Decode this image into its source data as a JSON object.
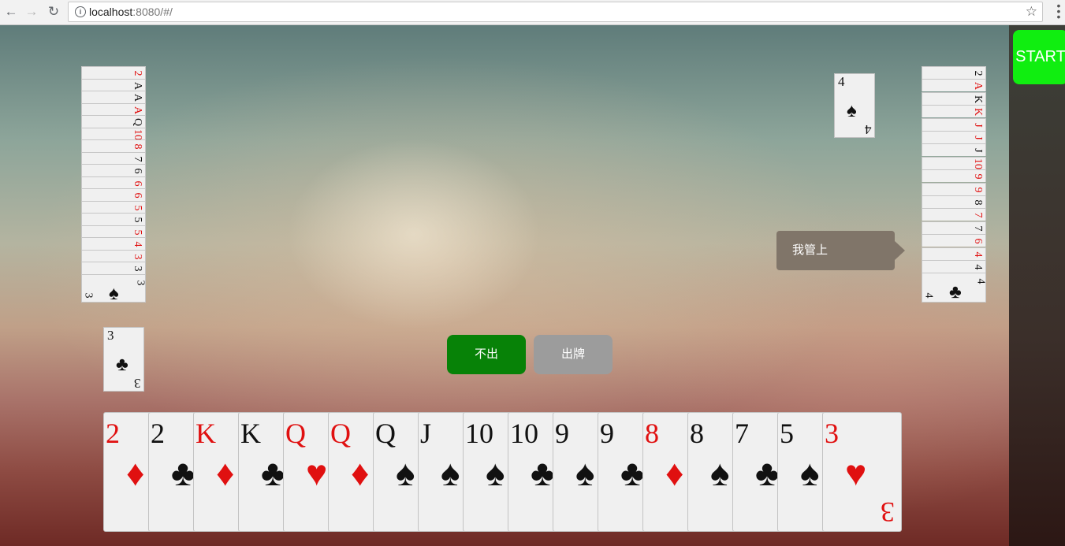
{
  "browser": {
    "url_host": "localhost",
    "url_rest": ":8080/#/",
    "back_icon": "←",
    "forward_icon": "→",
    "reload_icon": "↻",
    "star_icon": "☆",
    "menu_icon": "⋮"
  },
  "start_button": "START",
  "colors": {
    "start": "#10ee10",
    "pass": "#078207",
    "play": "#9c9c9c",
    "red_suit": "#e01010"
  },
  "left_player": {
    "stack_ranks": [
      "2",
      "A",
      "A",
      "A",
      "Q",
      "10",
      "8",
      "7",
      "6",
      "6",
      "6",
      "5",
      "5",
      "5",
      "4",
      "3",
      "3"
    ],
    "stack_colors": [
      "red",
      "black",
      "black",
      "red",
      "black",
      "red",
      "red",
      "black",
      "black",
      "red",
      "red",
      "red",
      "black",
      "red",
      "red",
      "red",
      "black"
    ],
    "last_card": {
      "rank": "3",
      "suit": "♠"
    },
    "played_card": {
      "rank": "3",
      "suit": "♣"
    }
  },
  "right_player": {
    "stack_ranks": [
      "2",
      "A",
      "K",
      "K",
      "J",
      "J",
      "J",
      "10",
      "9",
      "9",
      "8",
      "7",
      "7",
      "6",
      "4",
      "4"
    ],
    "stack_colors": [
      "black",
      "red",
      "black",
      "red",
      "red",
      "red",
      "black",
      "red",
      "red",
      "red",
      "black",
      "red",
      "black",
      "red",
      "red",
      "black"
    ],
    "last_card": {
      "rank": "4",
      "suit": "♣"
    },
    "played_card": {
      "rank": "4",
      "suit": "♠"
    },
    "speech": "我管上"
  },
  "actions": {
    "pass_label": "不出",
    "play_label": "出牌"
  },
  "hand": [
    {
      "rank": "2",
      "suit": "♦",
      "color": "red"
    },
    {
      "rank": "2",
      "suit": "♣",
      "color": "black"
    },
    {
      "rank": "K",
      "suit": "♦",
      "color": "red"
    },
    {
      "rank": "K",
      "suit": "♣",
      "color": "black"
    },
    {
      "rank": "Q",
      "suit": "♥",
      "color": "red"
    },
    {
      "rank": "Q",
      "suit": "♦",
      "color": "red"
    },
    {
      "rank": "Q",
      "suit": "♠",
      "color": "black"
    },
    {
      "rank": "J",
      "suit": "♠",
      "color": "black"
    },
    {
      "rank": "10",
      "suit": "♠",
      "color": "black"
    },
    {
      "rank": "10",
      "suit": "♣",
      "color": "black"
    },
    {
      "rank": "9",
      "suit": "♠",
      "color": "black"
    },
    {
      "rank": "9",
      "suit": "♣",
      "color": "black"
    },
    {
      "rank": "8",
      "suit": "♦",
      "color": "red"
    },
    {
      "rank": "8",
      "suit": "♠",
      "color": "black"
    },
    {
      "rank": "7",
      "suit": "♣",
      "color": "black"
    },
    {
      "rank": "5",
      "suit": "♠",
      "color": "black"
    },
    {
      "rank": "3",
      "suit": "♥",
      "color": "red"
    }
  ]
}
